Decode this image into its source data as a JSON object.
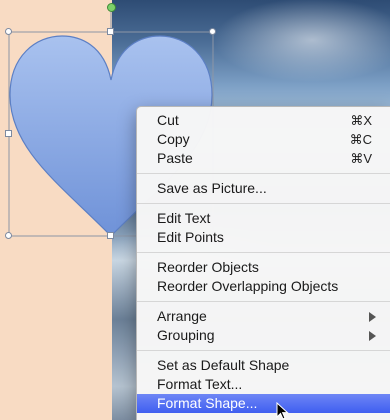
{
  "menu": {
    "cut": {
      "label": "Cut",
      "shortcut": "⌘X"
    },
    "copy": {
      "label": "Copy",
      "shortcut": "⌘C"
    },
    "paste": {
      "label": "Paste",
      "shortcut": "⌘V"
    },
    "save_as_picture": {
      "label": "Save as Picture..."
    },
    "edit_text": {
      "label": "Edit Text"
    },
    "edit_points": {
      "label": "Edit Points"
    },
    "reorder_objects": {
      "label": "Reorder Objects"
    },
    "reorder_overlapping": {
      "label": "Reorder Overlapping Objects"
    },
    "arrange": {
      "label": "Arrange"
    },
    "grouping": {
      "label": "Grouping"
    },
    "set_default_shape": {
      "label": "Set as Default Shape"
    },
    "format_text": {
      "label": "Format Text..."
    },
    "format_shape": {
      "label": "Format Shape..."
    }
  },
  "colors": {
    "heart_fill_top": "#a9c2ef",
    "heart_fill_bottom": "#6f92d8",
    "heart_stroke": "#5c7fc4",
    "highlight": "#3f5ef0",
    "canvas_left": "#f8dbc3"
  },
  "icons": {
    "submenu_arrow": "triangle-right",
    "cursor": "arrow-pointer"
  }
}
